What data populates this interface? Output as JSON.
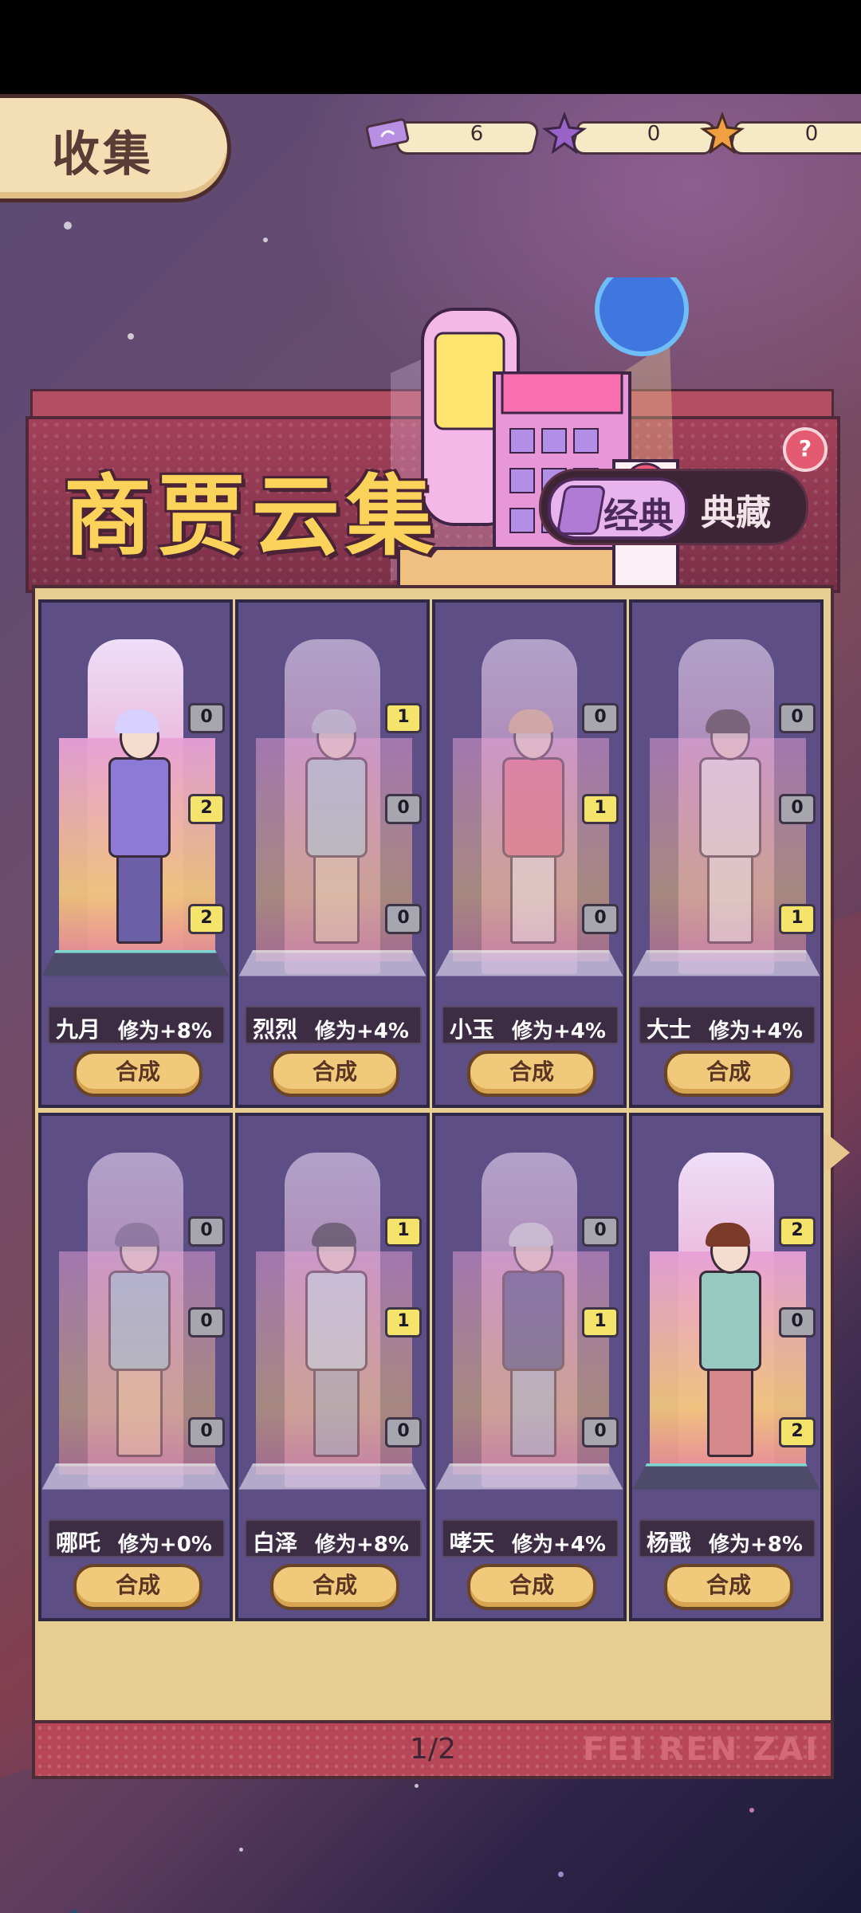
{
  "header": {
    "tab_label": "收集",
    "currencies": [
      {
        "icon": "ticket-icon",
        "value": "6"
      },
      {
        "icon": "purple-puzzle-icon",
        "value": "0"
      },
      {
        "icon": "orange-puzzle-icon",
        "value": "0"
      }
    ]
  },
  "banner": {
    "title": "商贾云集",
    "toggle_active": "经典",
    "toggle_inactive": "典藏",
    "help": "?"
  },
  "cards": [
    {
      "name": "九月",
      "bonus": "修为+8%",
      "badges": [
        "0",
        "2",
        "2"
      ],
      "lit": true,
      "button": "合成"
    },
    {
      "name": "烈烈",
      "bonus": "修为+4%",
      "badges": [
        "1",
        "0",
        "0"
      ],
      "lit": false,
      "button": "合成"
    },
    {
      "name": "小玉",
      "bonus": "修为+4%",
      "badges": [
        "0",
        "1",
        "0"
      ],
      "lit": false,
      "button": "合成"
    },
    {
      "name": "大士",
      "bonus": "修为+4%",
      "badges": [
        "0",
        "0",
        "1"
      ],
      "lit": false,
      "button": "合成"
    },
    {
      "name": "哪吒",
      "bonus": "修为+0%",
      "badges": [
        "0",
        "0",
        "0"
      ],
      "lit": false,
      "button": "合成"
    },
    {
      "name": "白泽",
      "bonus": "修为+8%",
      "badges": [
        "1",
        "1",
        "0"
      ],
      "lit": false,
      "button": "合成"
    },
    {
      "name": "哮天",
      "bonus": "修为+4%",
      "badges": [
        "0",
        "1",
        "0"
      ],
      "lit": false,
      "button": "合成"
    },
    {
      "name": "杨戬",
      "bonus": "修为+8%",
      "badges": [
        "2",
        "0",
        "2"
      ],
      "lit": true,
      "button": "合成"
    }
  ],
  "footer": {
    "page": "1/2",
    "brand": "FEI REN ZAI"
  },
  "colors": {
    "card_bg": "#5d4e86",
    "badge_active": "#f5e46b",
    "badge_inactive": "#a7a5ad",
    "button": "#f1c97a",
    "title": "#fbd35a"
  }
}
